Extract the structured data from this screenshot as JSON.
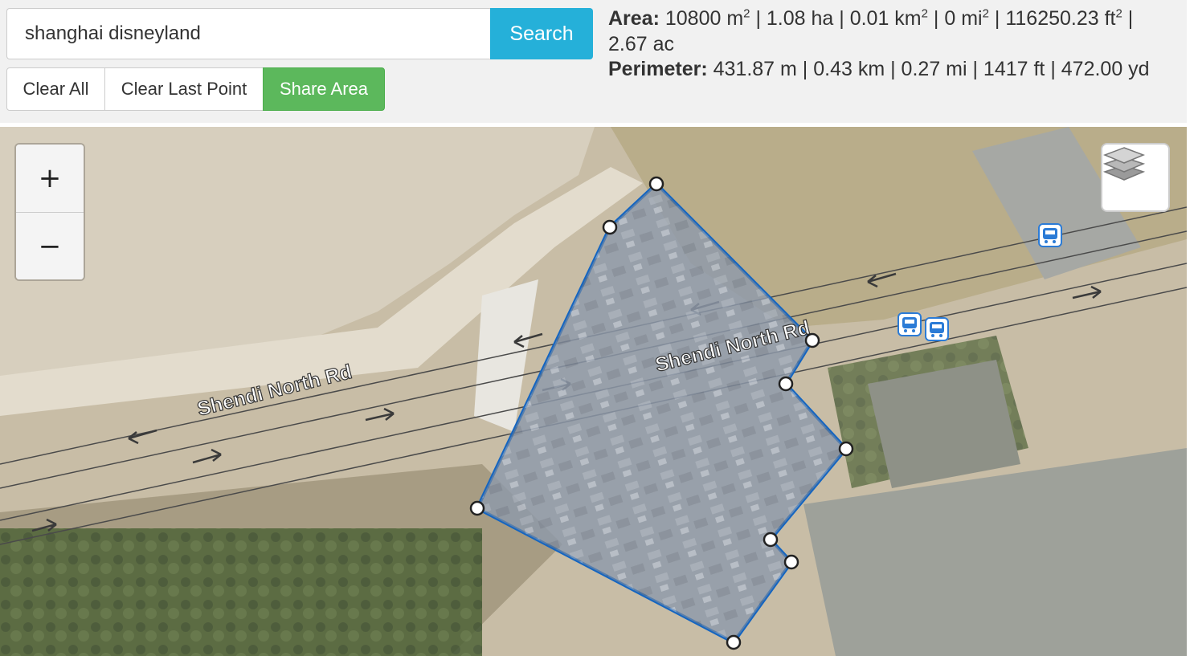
{
  "search": {
    "value": "shanghai disneyland",
    "button_label": "Search"
  },
  "actions": {
    "clear_all": "Clear All",
    "clear_last_point": "Clear Last Point",
    "share_area": "Share Area"
  },
  "area": {
    "label": "Area:",
    "m2": "10800 m",
    "ha": " | 1.08 ha | 0.01 km",
    "km2_tail": " | 0 mi",
    "mi2_tail": " | 116250.23 ft",
    "ac": " | 2.67 ac",
    "sup": "2"
  },
  "perimeter": {
    "label": "Perimeter:",
    "text": "431.87 m | 0.43 km | 0.27 mi | 1417 ft | 472.00 yd"
  },
  "map": {
    "road_label": "Shendi North Rd",
    "zoom_in": "+",
    "zoom_out": "−",
    "layers_icon": "layers-icon",
    "bus_icon": "bus-stop-icon",
    "polygon_color": "#1565c0",
    "polygon_fill": "#8fa6c8"
  }
}
